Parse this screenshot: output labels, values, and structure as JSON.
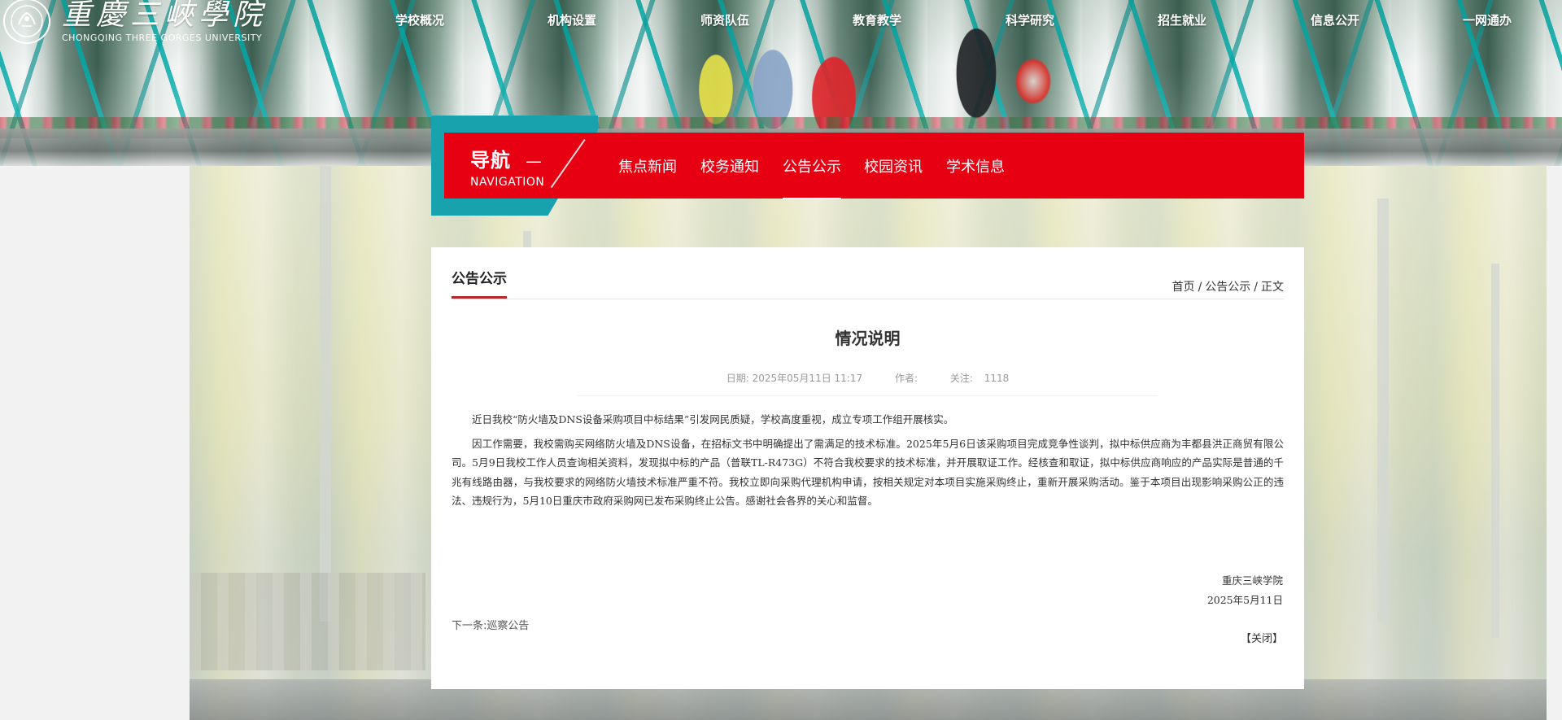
{
  "header": {
    "logo_cn": "重慶三峽學院",
    "logo_en": "CHONGQING THREE GORGES UNIVERSITY",
    "nav": [
      "学校概况",
      "机构设置",
      "师资队伍",
      "教育教学",
      "科学研究",
      "招生就业",
      "信息公开",
      "一网通办"
    ]
  },
  "subnav": {
    "title_cn": "导航",
    "title_dash": "—",
    "title_en": "NAVIGATION",
    "tabs": [
      "焦点新闻",
      "校务通知",
      "公告公示",
      "校园资讯",
      "学术信息"
    ],
    "active_tab": "公告公示",
    "accent_red": "#e60012",
    "accent_teal": "#17a2ad"
  },
  "content": {
    "section_title": "公告公示",
    "breadcrumb": [
      "首页",
      "公告公示",
      "正文"
    ],
    "breadcrumb_sep": "/",
    "article_title": "情况说明",
    "meta": {
      "date_label": "日期: 2025年05月11日 11:17",
      "author_label": "作者:",
      "views_label": "关注:",
      "views_value": "1118"
    },
    "paragraphs": [
      "近日我校“防火墙及DNS设备采购项目中标结果”引发网民质疑，学校高度重视，成立专项工作组开展核实。",
      "因工作需要，我校需购买网络防火墙及DNS设备，在招标文书中明确提出了需满足的技术标准。2025年5月6日该采购项目完成竞争性谈判，拟中标供应商为丰都县洪正商贸有限公司。5月9日我校工作人员查询相关资料，发现拟中标的产品（普联TL-R473G）不符合我校要求的技术标准，并开展取证工作。经核查和取证，拟中标供应商响应的产品实际是普通的千兆有线路由器，与我校要求的网络防火墙技术标准严重不符。我校立即向采购代理机构申请，按相关规定对本项目实施采购终止，重新开展采购活动。鉴于本项目出现影响采购公正的违法、违规行为，5月10日重庆市政府采购网已发布采购终止公告。感谢社会各界的关心和监督。"
    ],
    "sign_org": "重庆三峡学院",
    "sign_date": "2025年5月11日",
    "next_label": "下一条:巡察公告",
    "close_label": "【关闭】"
  }
}
